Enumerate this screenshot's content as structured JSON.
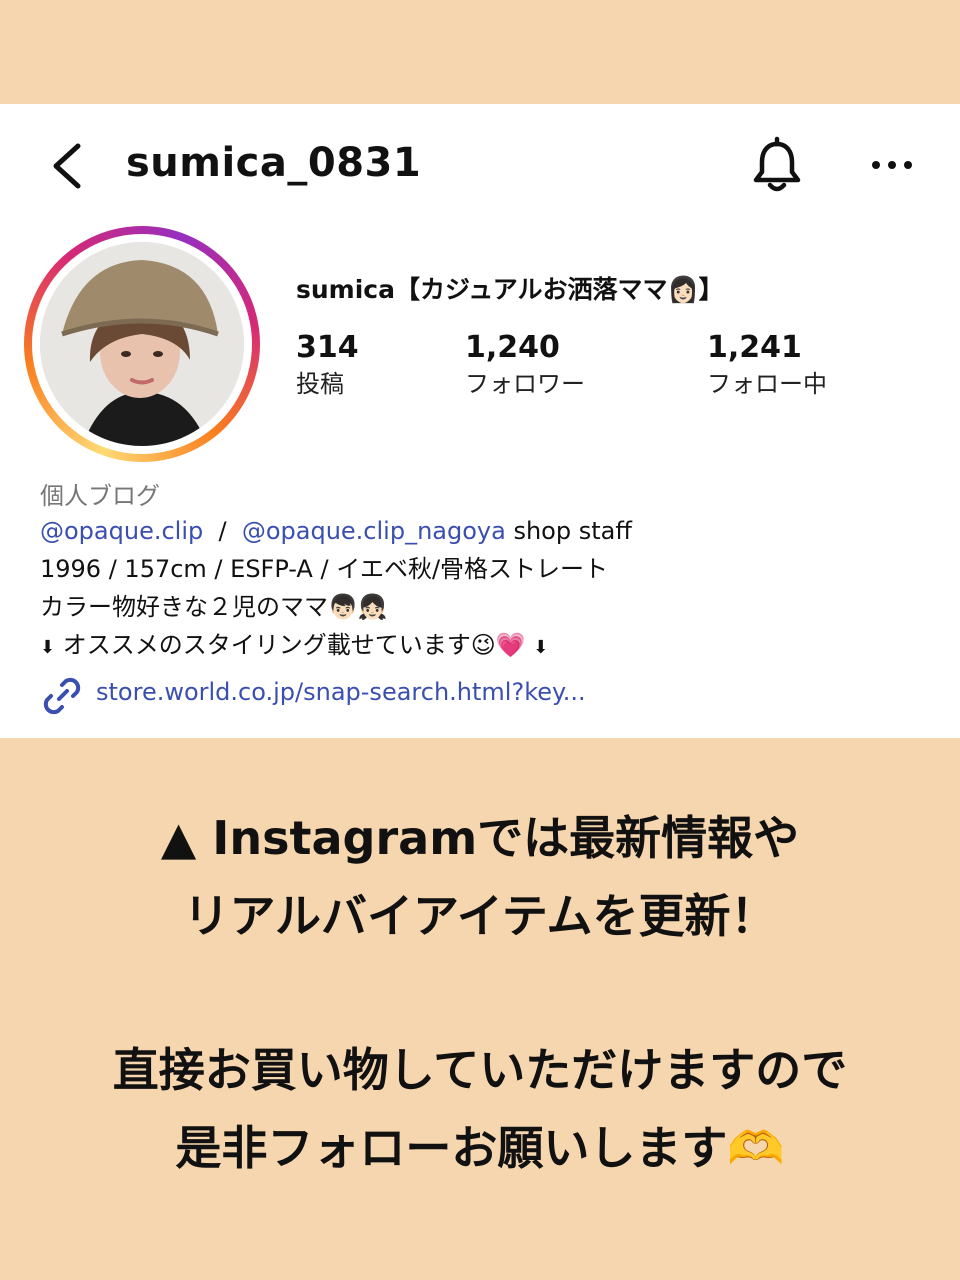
{
  "profile": {
    "username": "sumica_0831",
    "display_name": "sumica【カジュアルお洒落ママ👩🏻】",
    "stats": [
      {
        "value": "314",
        "label": "投稿"
      },
      {
        "value": "1,240",
        "label": "フォロワー"
      },
      {
        "value": "1,241",
        "label": "フォロー中"
      }
    ],
    "category": "個人ブログ",
    "bio": {
      "mention1": "@opaque.clip",
      "sep": "  /  ",
      "mention2": "@opaque.clip_nagoya",
      "role": " shop staff",
      "line2": "1996 / 157cm / ESFP-A / イエベ秋/骨格ストレート",
      "line3": "カラー物好きな２児のママ👦🏻👧🏻",
      "line4_arrow": "⬇",
      "line4": " オススメのスタイリング載せています😉💗 ",
      "line4_arrow_end": "⬇"
    },
    "link": "store.world.co.jp/snap-search.html?key..."
  },
  "icons": {
    "back": "chevron-left-icon",
    "bell": "bell-icon",
    "more": "more-horizontal-icon",
    "link": "link-icon"
  },
  "colors": {
    "background": "#F6D6AE",
    "link": "#3A4FB0"
  },
  "caption": {
    "line1": "▲ Instagramでは最新情報や",
    "line2": "リアルバイアイテムを更新！",
    "line3": "直接お買い物していただけますので",
    "line4": "是非フォローお願いします🫶"
  }
}
